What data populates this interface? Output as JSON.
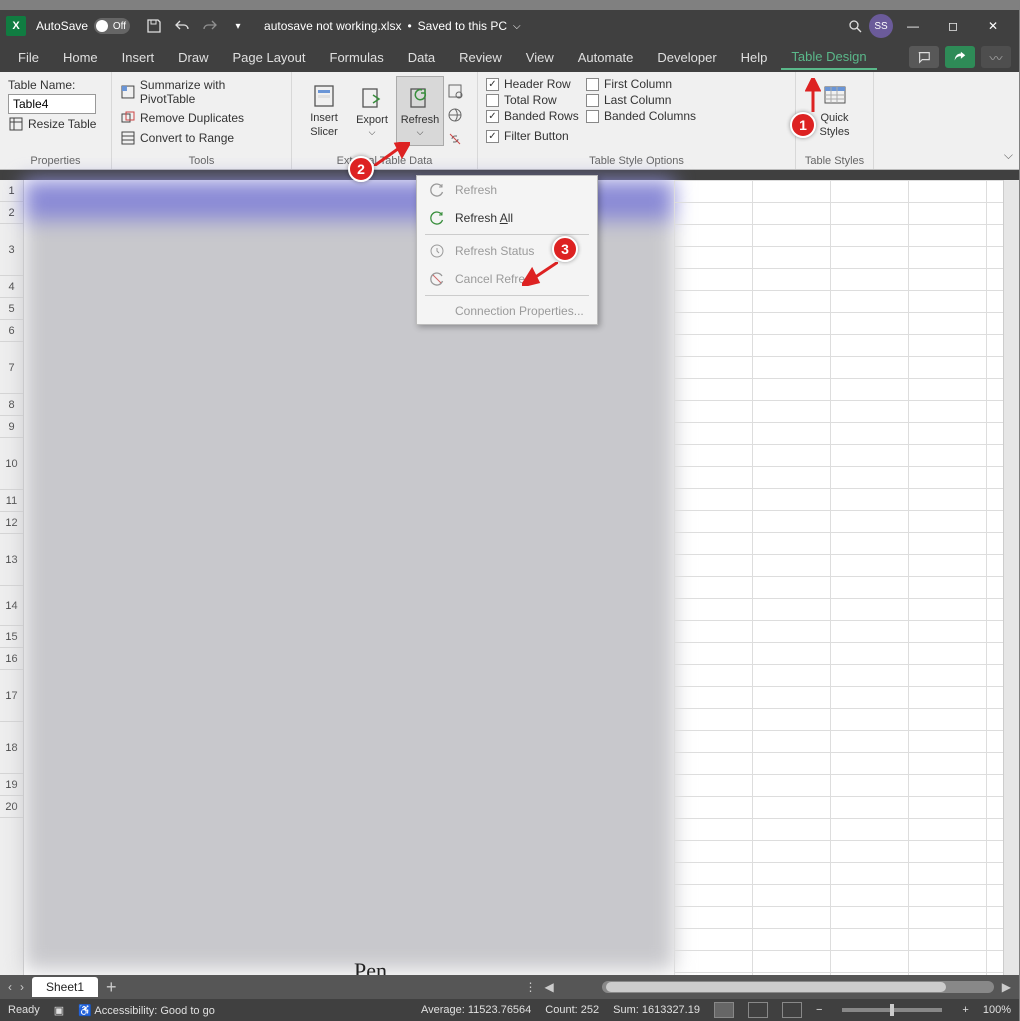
{
  "title": {
    "autosave_label": "AutoSave",
    "autosave_state": "Off",
    "filename": "autosave not working.xlsx",
    "saved_state": "Saved to this PC",
    "avatar": "SS"
  },
  "tabs": {
    "file": "File",
    "home": "Home",
    "insert": "Insert",
    "draw": "Draw",
    "page_layout": "Page Layout",
    "formulas": "Formulas",
    "data": "Data",
    "review": "Review",
    "view": "View",
    "automate": "Automate",
    "developer": "Developer",
    "help": "Help",
    "table_design": "Table Design"
  },
  "ribbon": {
    "properties": {
      "table_name_label": "Table Name:",
      "table_name_value": "Table4",
      "resize": "Resize Table",
      "group": "Properties"
    },
    "tools": {
      "pivot": "Summarize with PivotTable",
      "dupes": "Remove Duplicates",
      "range": "Convert to Range",
      "group": "Tools"
    },
    "external": {
      "slicer": "Insert\nSlicer",
      "export": "Export",
      "refresh": "Refresh",
      "group": "External Table Data"
    },
    "style_options": {
      "header_row": "Header Row",
      "total_row": "Total Row",
      "banded_rows": "Banded Rows",
      "first_col": "First Column",
      "last_col": "Last Column",
      "banded_cols": "Banded Columns",
      "filter_btn": "Filter Button",
      "group": "Table Style Options"
    },
    "styles": {
      "quick": "Quick\nStyles",
      "group": "Table Styles"
    }
  },
  "dropdown": {
    "refresh": "Refresh",
    "refresh_all": "Refresh All",
    "status": "Refresh Status",
    "cancel": "Cancel Refresh",
    "props": "Connection Properties..."
  },
  "rows": [
    "1",
    "2",
    "3",
    "4",
    "5",
    "6",
    "7",
    "8",
    "9",
    "10",
    "11",
    "12",
    "13",
    "14",
    "15",
    "16",
    "17",
    "18",
    "19",
    "20"
  ],
  "sheet": {
    "active": "Sheet1"
  },
  "status": {
    "ready": "Ready",
    "access": "Accessibility: Good to go",
    "avg": "Average: 11523.76564",
    "count": "Count: 252",
    "sum": "Sum: 1613327.19",
    "zoom": "100%"
  },
  "callouts": {
    "c1": "1",
    "c2": "2",
    "c3": "3"
  },
  "word": "Pen"
}
